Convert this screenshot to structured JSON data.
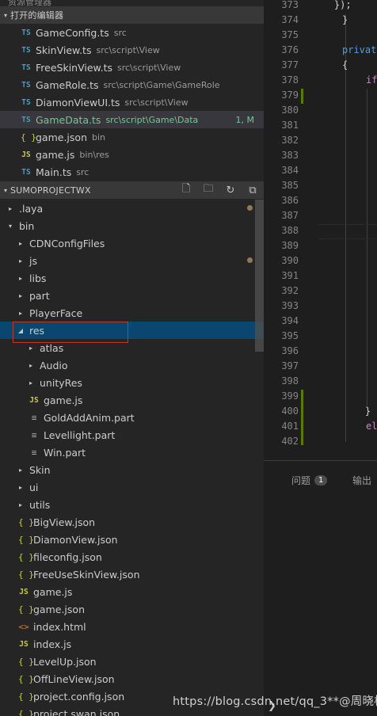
{
  "top_stub": "资源管理器",
  "open_editors": {
    "header": "打开的编辑器",
    "files": [
      {
        "icon": "TS",
        "name": "GameConfig.ts",
        "path": "src"
      },
      {
        "icon": "TS",
        "name": "SkinView.ts",
        "path": "src\\script\\View"
      },
      {
        "icon": "TS",
        "name": "FreeSkinView.ts",
        "path": "src\\script\\View"
      },
      {
        "icon": "TS",
        "name": "GameRole.ts",
        "path": "src\\script\\Game\\GameRole"
      },
      {
        "icon": "TS",
        "name": "DiamonViewUI.ts",
        "path": "src\\script\\View"
      },
      {
        "icon": "TS",
        "name": "GameData.ts",
        "path": "src\\script\\Game\\Data",
        "badge": "1, M"
      },
      {
        "icon": "{ }",
        "name": "game.json",
        "path": "bin"
      },
      {
        "icon": "JS",
        "name": "game.js",
        "path": "bin\\res"
      },
      {
        "icon": "TS",
        "name": "Main.ts",
        "path": "src"
      }
    ]
  },
  "project": {
    "header": "SUMOPROJECTWX",
    "tree": [
      {
        "name": ".laya",
        "arrow": "▸",
        "depth": 0
      },
      {
        "name": "bin",
        "arrow": "▾",
        "depth": 0
      },
      {
        "name": "CDNConfigFiles",
        "arrow": "▸",
        "depth": 1
      },
      {
        "name": "js",
        "arrow": "▸",
        "depth": 1
      },
      {
        "name": "libs",
        "arrow": "▸",
        "depth": 1
      },
      {
        "name": "part",
        "arrow": "▸",
        "depth": 1
      },
      {
        "name": "PlayerFace",
        "arrow": "▸",
        "depth": 1
      },
      {
        "name": "res",
        "arrow": "◢",
        "depth": 1
      },
      {
        "name": "atlas",
        "arrow": "▸",
        "depth": 2
      },
      {
        "name": "Audio",
        "arrow": "▸",
        "depth": 2
      },
      {
        "name": "unityRes",
        "arrow": "▸",
        "depth": 2
      },
      {
        "name": "game.js",
        "icon": "JS",
        "depth": 2
      },
      {
        "name": "GoldAddAnim.part",
        "icon": "≡",
        "depth": 2
      },
      {
        "name": "Levellight.part",
        "icon": "≡",
        "depth": 2
      },
      {
        "name": "Win.part",
        "icon": "≡",
        "depth": 2
      },
      {
        "name": "Skin",
        "arrow": "▸",
        "depth": 1
      },
      {
        "name": "ui",
        "arrow": "▸",
        "depth": 1
      },
      {
        "name": "utils",
        "arrow": "▸",
        "depth": 1
      },
      {
        "name": "BigView.json",
        "icon": "{ }",
        "depth": 1
      },
      {
        "name": "DiamonView.json",
        "icon": "{ }",
        "depth": 1
      },
      {
        "name": "fileconfig.json",
        "icon": "{ }",
        "depth": 1
      },
      {
        "name": "FreeUseSkinView.json",
        "icon": "{ }",
        "depth": 1
      },
      {
        "name": "game.js",
        "icon": "JS",
        "depth": 1
      },
      {
        "name": "game.json",
        "icon": "{ }",
        "depth": 1
      },
      {
        "name": "index.html",
        "icon": "<>",
        "depth": 1
      },
      {
        "name": "index.js",
        "icon": "JS",
        "depth": 1
      },
      {
        "name": "LevelUp.json",
        "icon": "{ }",
        "depth": 1
      },
      {
        "name": "OffLineView.json",
        "icon": "{ }",
        "depth": 1
      },
      {
        "name": "project.config.json",
        "icon": "{ }",
        "depth": 1
      },
      {
        "name": "project.swan.json",
        "icon": "{ }",
        "depth": 1
      }
    ]
  },
  "editor": {
    "line_numbers": [
      "373",
      "374",
      "375",
      "376",
      "377",
      "378",
      "379",
      "380",
      "381",
      "382",
      "383",
      "384",
      "385",
      "386",
      "387",
      "388",
      "389",
      "390",
      "391",
      "392",
      "393",
      "394",
      "395",
      "396",
      "397",
      "398",
      "399",
      "400",
      "401",
      "402"
    ],
    "code": {
      "l373": "    });",
      "l374": "}",
      "l376_kw": "privat",
      "l377": "{",
      "l378_kw": "if",
      "l400": "    }",
      "l401_kw": "el"
    }
  },
  "panel": {
    "problems_label": "问题",
    "problems_count": "1",
    "output_label": "输出"
  },
  "watermark": "https://blog.csdn.net/qq_3**@周晓松",
  "colors": {
    "accent_selection": "#094771",
    "modified_green": "#73c991",
    "ts_blue": "#519aba",
    "js_yellow": "#cbcb41",
    "highlight_box": "#c0392b"
  }
}
